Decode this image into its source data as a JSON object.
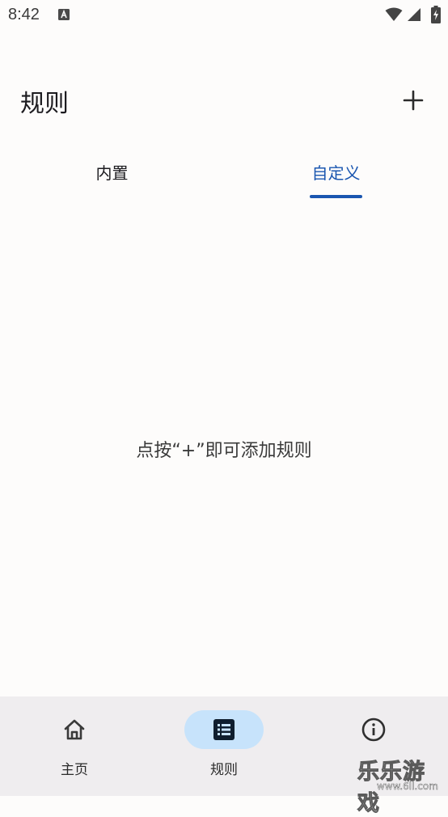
{
  "status_bar": {
    "time": "8:42",
    "notification_icon": "a-box-icon",
    "wifi_icon": "wifi-icon",
    "signal_icon": "signal-icon",
    "battery_icon": "battery-charging-icon"
  },
  "app_bar": {
    "title": "规则",
    "add_icon": "plus-icon"
  },
  "tabs": [
    {
      "label": "内置",
      "selected": false
    },
    {
      "label": "自定义",
      "selected": true
    }
  ],
  "empty_state": {
    "message": "点按“+”即可添加规则"
  },
  "bottom_nav": [
    {
      "label": "主页",
      "icon": "home-icon",
      "selected": false
    },
    {
      "label": "规则",
      "icon": "list-icon",
      "selected": true
    },
    {
      "label": "",
      "icon": "info-icon",
      "selected": false
    }
  ],
  "watermark": {
    "big": "乐乐游戏",
    "small": "www.6ll.com"
  },
  "colors": {
    "accent": "#1a56b0",
    "nav_pill": "#c7e3fb",
    "nav_background": "#efedef",
    "background": "#fdfcfb"
  }
}
